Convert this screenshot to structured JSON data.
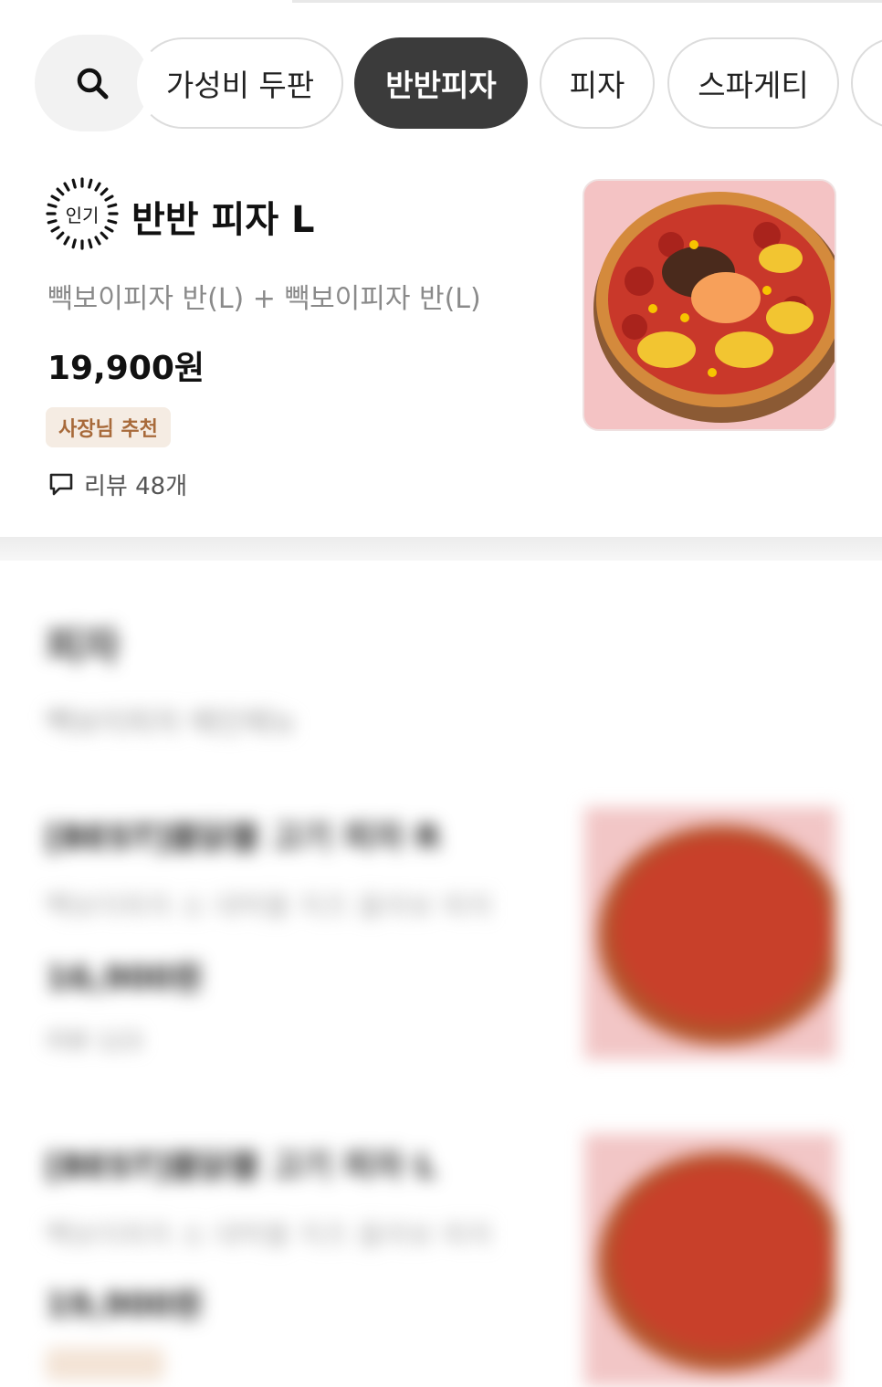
{
  "categories": {
    "search_icon": "search-icon",
    "chips": [
      {
        "label": "가성비 두판",
        "active": false
      },
      {
        "label": "반반피자",
        "active": true
      },
      {
        "label": "피자",
        "active": false
      },
      {
        "label": "스파게티",
        "active": false
      }
    ]
  },
  "featured": {
    "popular_badge": "인기",
    "title": "반반 피자 L",
    "description": "빽보이피자 반(L) + 빽보이피자 반(L)",
    "price": "19,900원",
    "owner_badge": "사장님 추천",
    "review_text": "리뷰 48개",
    "review_icon": "chat-bubble-icon",
    "photo_icon": "pizza-photo"
  },
  "blurred_section": {
    "title": "피자",
    "subtitle": "빽보이피자 메인메뉴",
    "items": [
      {
        "title": "[BEST]불닭불 고기 피자 R",
        "desc": "빽보이피자 소 대박불 치즈 올라보 피자",
        "price": "16,900원",
        "meta": "리뷰 123"
      },
      {
        "title": "[BEST]불닭불 고기 피자 L",
        "desc": "빽보이피자 소 대박불 치즈 올라보 피자",
        "price": "19,900원",
        "meta": ""
      }
    ]
  },
  "colors": {
    "active_chip": "#3b3b3b",
    "owner_badge_bg": "#f5ece3",
    "owner_badge_text": "#a86a3a"
  }
}
